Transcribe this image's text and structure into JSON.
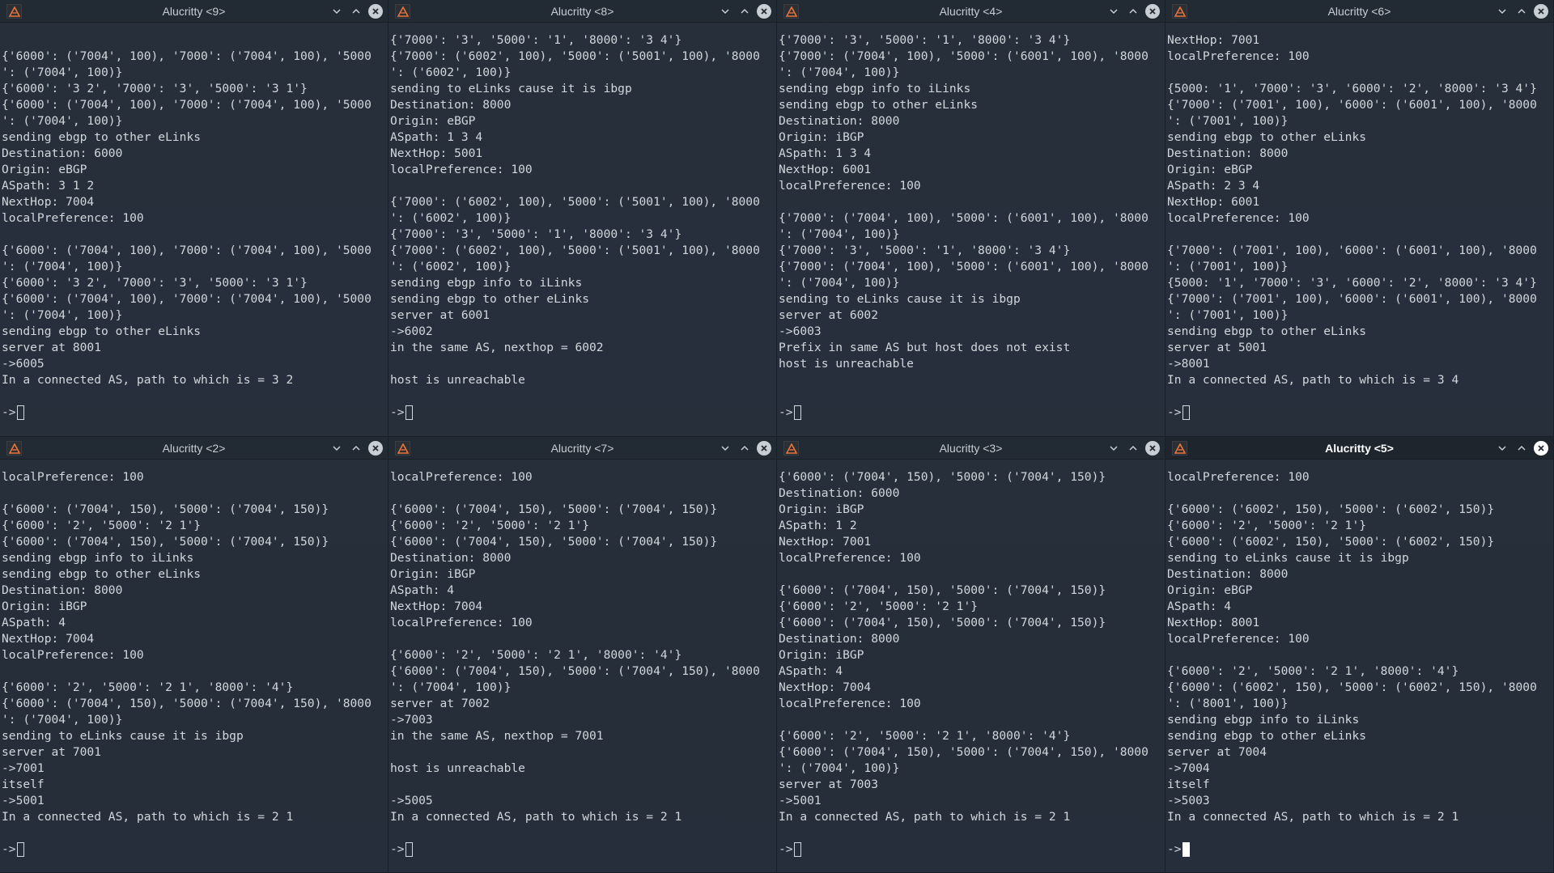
{
  "windows": [
    {
      "title": "Alucritty <9>",
      "lines": [
        "",
        "{'6000': ('7004', 100), '7000': ('7004', 100), '5000",
        "': ('7004', 100)}",
        "{'6000': '3 2', '7000': '3', '5000': '3 1'}",
        "{'6000': ('7004', 100), '7000': ('7004', 100), '5000",
        "': ('7004', 100)}",
        "sending ebgp to other eLinks",
        "Destination: 6000",
        "Origin: eBGP",
        "ASpath: 3 1 2",
        "NextHop: 7004",
        "localPreference: 100",
        "",
        "{'6000': ('7004', 100), '7000': ('7004', 100), '5000",
        "': ('7004', 100)}",
        "{'6000': '3 2', '7000': '3', '5000': '3 1'}",
        "{'6000': ('7004', 100), '7000': ('7004', 100), '5000",
        "': ('7004', 100)}",
        "sending ebgp to other eLinks",
        "server at 8001",
        "->6005",
        "In a connected AS, path to which is = 3 2"
      ],
      "prompt": "->"
    },
    {
      "title": "Alucritty <8>",
      "lines": [
        "{'7000': '3', '5000': '1', '8000': '3 4'}",
        "{'7000': ('6002', 100), '5000': ('5001', 100), '8000",
        "': ('6002', 100)}",
        "sending to eLinks cause it is ibgp",
        "Destination: 8000",
        "Origin: eBGP",
        "ASpath: 1 3 4",
        "NextHop: 5001",
        "localPreference: 100",
        "",
        "{'7000': ('6002', 100), '5000': ('5001', 100), '8000",
        "': ('6002', 100)}",
        "{'7000': '3', '5000': '1', '8000': '3 4'}",
        "{'7000': ('6002', 100), '5000': ('5001', 100), '8000",
        "': ('6002', 100)}",
        "sending ebgp info to iLinks",
        "sending ebgp to other eLinks",
        "server at 6001",
        "->6002",
        "in the same AS, nexthop = 6002",
        "",
        "host is unreachable"
      ],
      "prompt": "->"
    },
    {
      "title": "Alucritty <4>",
      "lines": [
        "{'7000': '3', '5000': '1', '8000': '3 4'}",
        "{'7000': ('7004', 100), '5000': ('6001', 100), '8000",
        "': ('7004', 100)}",
        "sending ebgp info to iLinks",
        "sending ebgp to other eLinks",
        "Destination: 8000",
        "Origin: iBGP",
        "ASpath: 1 3 4",
        "NextHop: 6001",
        "localPreference: 100",
        "",
        "{'7000': ('7004', 100), '5000': ('6001', 100), '8000",
        "': ('7004', 100)}",
        "{'7000': '3', '5000': '1', '8000': '3 4'}",
        "{'7000': ('7004', 100), '5000': ('6001', 100), '8000",
        "': ('7004', 100)}",
        "sending to eLinks cause it is ibgp",
        "server at 6002",
        "->6003",
        "Prefix in same AS but host does not exist",
        "host is unreachable",
        ""
      ],
      "prompt": "->"
    },
    {
      "title": "Alucritty <6>",
      "lines": [
        "NextHop: 7001",
        "localPreference: 100",
        "",
        "{5000: '1', '7000': '3', '6000': '2', '8000': '3 4'}",
        "{'7000': ('7001', 100), '6000': ('6001', 100), '8000",
        "': ('7001', 100)}",
        "sending ebgp to other eLinks",
        "Destination: 8000",
        "Origin: eBGP",
        "ASpath: 2 3 4",
        "NextHop: 6001",
        "localPreference: 100",
        "",
        "{'7000': ('7001', 100), '6000': ('6001', 100), '8000",
        "': ('7001', 100)}",
        "{5000: '1', '7000': '3', '6000': '2', '8000': '3 4'}",
        "{'7000': ('7001', 100), '6000': ('6001', 100), '8000",
        "': ('7001', 100)}",
        "sending ebgp to other eLinks",
        "server at 5001",
        "->8001",
        "In a connected AS, path to which is = 3 4"
      ],
      "prompt": "->"
    },
    {
      "title": "Alucritty <2>",
      "lines": [
        "localPreference: 100",
        "",
        "{'6000': ('7004', 150), '5000': ('7004', 150)}",
        "{'6000': '2', '5000': '2 1'}",
        "{'6000': ('7004', 150), '5000': ('7004', 150)}",
        "sending ebgp info to iLinks",
        "sending ebgp to other eLinks",
        "Destination: 8000",
        "Origin: iBGP",
        "ASpath: 4",
        "NextHop: 7004",
        "localPreference: 100",
        "",
        "{'6000': '2', '5000': '2 1', '8000': '4'}",
        "{'6000': ('7004', 150), '5000': ('7004', 150), '8000",
        "': ('7004', 100)}",
        "sending to eLinks cause it is ibgp",
        "server at 7001",
        "->7001",
        "itself",
        "->5001",
        "In a connected AS, path to which is = 2 1"
      ],
      "prompt": "->"
    },
    {
      "title": "Alucritty <7>",
      "lines": [
        "localPreference: 100",
        "",
        "{'6000': ('7004', 150), '5000': ('7004', 150)}",
        "{'6000': '2', '5000': '2 1'}",
        "{'6000': ('7004', 150), '5000': ('7004', 150)}",
        "Destination: 8000",
        "Origin: iBGP",
        "ASpath: 4",
        "NextHop: 7004",
        "localPreference: 100",
        "",
        "{'6000': '2', '5000': '2 1', '8000': '4'}",
        "{'6000': ('7004', 150), '5000': ('7004', 150), '8000",
        "': ('7004', 100)}",
        "server at 7002",
        "->7003",
        "in the same AS, nexthop = 7001",
        "",
        "host is unreachable",
        "",
        "->5005",
        "In a connected AS, path to which is = 2 1"
      ],
      "prompt": "->"
    },
    {
      "title": "Alucritty <3>",
      "lines": [
        "{'6000': ('7004', 150), '5000': ('7004', 150)}",
        "Destination: 6000",
        "Origin: iBGP",
        "ASpath: 1 2",
        "NextHop: 7001",
        "localPreference: 100",
        "",
        "{'6000': ('7004', 150), '5000': ('7004', 150)}",
        "{'6000': '2', '5000': '2 1'}",
        "{'6000': ('7004', 150), '5000': ('7004', 150)}",
        "Destination: 8000",
        "Origin: iBGP",
        "ASpath: 4",
        "NextHop: 7004",
        "localPreference: 100",
        "",
        "{'6000': '2', '5000': '2 1', '8000': '4'}",
        "{'6000': ('7004', 150), '5000': ('7004', 150), '8000",
        "': ('7004', 100)}",
        "server at 7003",
        "->5001",
        "In a connected AS, path to which is = 2 1"
      ],
      "prompt": "->"
    },
    {
      "title": "Alucritty <5>",
      "lines": [
        "localPreference: 100",
        "",
        "{'6000': ('6002', 150), '5000': ('6002', 150)}",
        "{'6000': '2', '5000': '2 1'}",
        "{'6000': ('6002', 150), '5000': ('6002', 150)}",
        "sending to eLinks cause it is ibgp",
        "Destination: 8000",
        "Origin: eBGP",
        "ASpath: 4",
        "NextHop: 8001",
        "localPreference: 100",
        "",
        "{'6000': '2', '5000': '2 1', '8000': '4'}",
        "{'6000': ('6002', 150), '5000': ('6002', 150), '8000",
        "': ('8001', 100)}",
        "sending ebgp info to iLinks",
        "sending ebgp to other eLinks",
        "server at 7004",
        "->7004",
        "itself",
        "->5003",
        "In a connected AS, path to which is = 2 1"
      ],
      "prompt": "->"
    }
  ],
  "active_window": 7,
  "colors": {
    "terminal_bg": "#262f3a",
    "titlebar_bg": "#222a33",
    "text": "#d2d7dc",
    "icon_accent": "#e8743b"
  }
}
